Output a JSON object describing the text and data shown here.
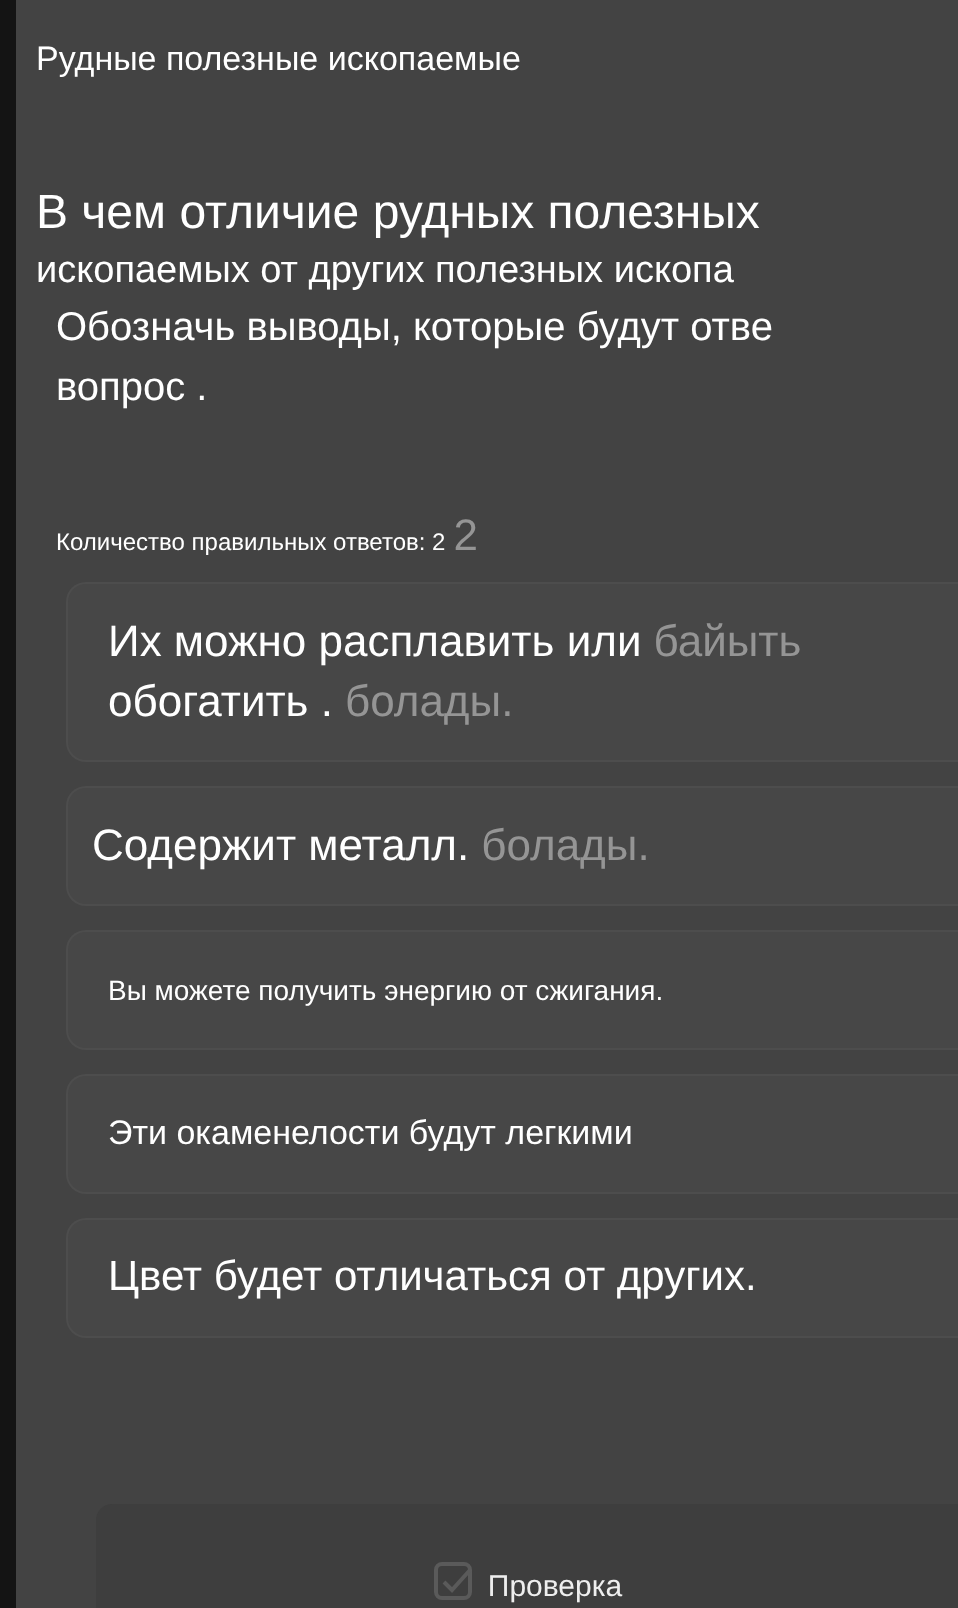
{
  "title": "Рудные полезные ископаемые",
  "question": [
    "В чем отличие рудных полезных",
    "ископаемых от других полезных ископа",
    "Обозначь выводы, которые будут отве",
    "вопрос ."
  ],
  "answer_count": {
    "text": "Количество правильных ответов: 2",
    "ghost": "2"
  },
  "options": [
    {
      "lines": [
        {
          "text": "Их можно расплавить или",
          "ghost": "байыть"
        },
        {
          "text": "обогатить .",
          "ghost": "болады."
        }
      ]
    },
    {
      "lines": [
        {
          "text": "Содержит металл.",
          "ghost": "болады."
        }
      ]
    },
    {
      "lines": [
        {
          "text": "Вы можете получить энергию от сжигания."
        }
      ]
    },
    {
      "lines": [
        {
          "text": "Эти окаменелости будут легкими"
        }
      ]
    },
    {
      "lines": [
        {
          "text": "Цвет будет отличаться от других."
        }
      ]
    }
  ],
  "check_button": "Проверка"
}
